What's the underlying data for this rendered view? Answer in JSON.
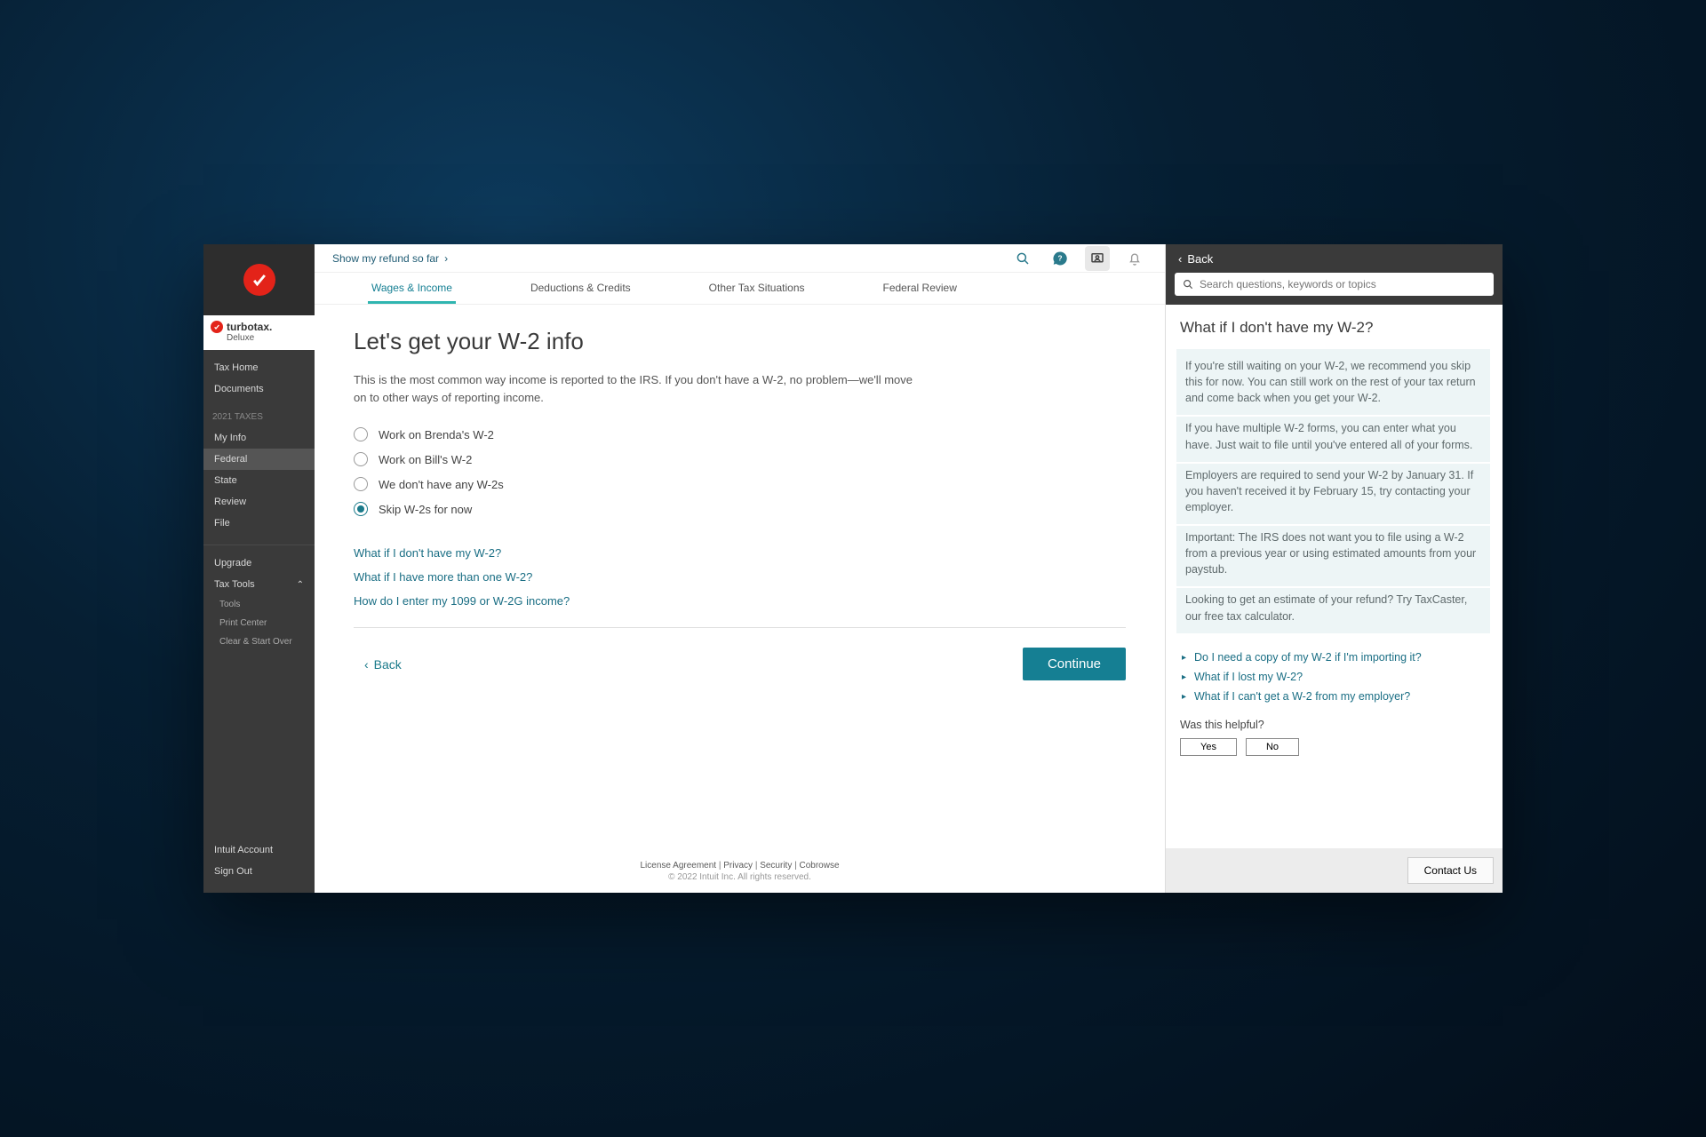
{
  "brand": {
    "name": "turbotax.",
    "tier": "Deluxe"
  },
  "sidebar": {
    "top": [
      "Tax Home",
      "Documents"
    ],
    "taxes_label": "2021 TAXES",
    "taxes": [
      "My Info",
      "Federal",
      "State",
      "Review",
      "File"
    ],
    "selected_tax": "Federal",
    "upgrade": "Upgrade",
    "tax_tools": "Tax Tools",
    "tools": [
      "Tools",
      "Print Center",
      "Clear & Start Over"
    ],
    "bottom": [
      "Intuit Account",
      "Sign Out"
    ]
  },
  "topbar": {
    "refund_link": "Show my refund so far"
  },
  "tabs": [
    "Wages & Income",
    "Deductions & Credits",
    "Other Tax Situations",
    "Federal Review"
  ],
  "active_tab": "Wages & Income",
  "page": {
    "title": "Let's get your W-2 info",
    "desc": "This is the most common way income is reported to the IRS. If you don't have a W-2, no problem—we'll move on to other ways of reporting income.",
    "radios": [
      "Work on Brenda's W-2",
      "Work on Bill's W-2",
      "We don't have any W-2s",
      "Skip W-2s for now"
    ],
    "selected_radio": 3,
    "questions": [
      "What if I don't have my W-2?",
      "What if I have more than one W-2?",
      "How do I enter my 1099 or W-2G income?"
    ],
    "back": "Back",
    "continue": "Continue"
  },
  "footer": {
    "links": [
      "License Agreement",
      "Privacy",
      "Security",
      "Cobrowse"
    ],
    "copy": "© 2022 Intuit Inc. All rights reserved."
  },
  "help": {
    "back": "Back",
    "search_placeholder": "Search questions, keywords or topics",
    "title": "What if I don't have my W-2?",
    "paras": [
      "If you're still waiting on your W-2, we recommend you skip this for now. You can still work on the rest of your tax return and come back when you get your W-2.",
      "If you have multiple W-2 forms, you can enter what you have. Just wait to file until you've entered all of your forms.",
      "Employers are required to send your W-2 by January 31. If you haven't received it by February 15, try contacting your employer.",
      "Important: The IRS does not want you to file using a W-2 from a previous year or using estimated amounts from your paystub.",
      "Looking to get an estimate of your refund? Try TaxCaster, our free tax calculator."
    ],
    "related": [
      "Do I need a copy of my W-2 if I'm importing it?",
      "What if I lost my W-2?",
      "What if I can't get a W-2 from my employer?"
    ],
    "helpful_label": "Was this helpful?",
    "yes": "Yes",
    "no": "No",
    "contact": "Contact Us"
  }
}
